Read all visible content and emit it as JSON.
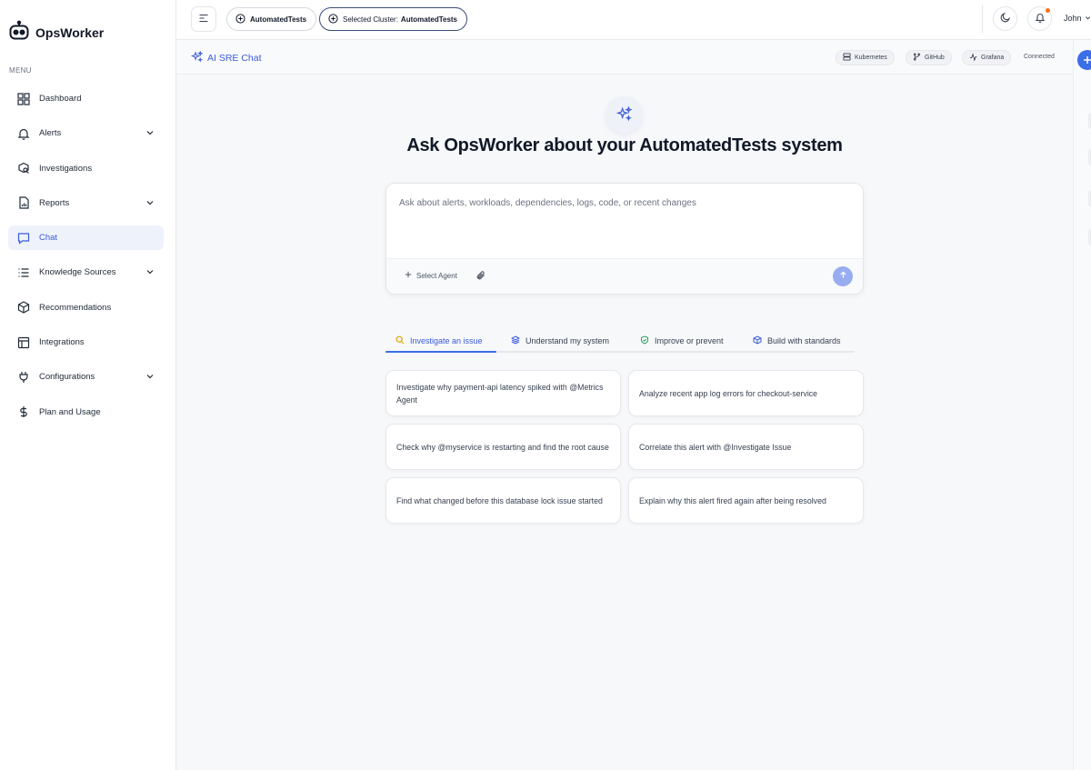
{
  "app": {
    "name": "OpsWorker"
  },
  "sidebar": {
    "menu_label": "MENU",
    "items": [
      {
        "label": "Dashboard",
        "icon": "grid-icon"
      },
      {
        "label": "Alerts",
        "icon": "bell-icon"
      },
      {
        "label": "Investigations",
        "icon": "search-box-icon"
      },
      {
        "label": "Reports",
        "icon": "report-icon"
      },
      {
        "label": "Chat",
        "icon": "chat-icon"
      },
      {
        "label": "Knowledge Sources",
        "icon": "list-icon"
      },
      {
        "label": "Recommendations",
        "icon": "cube-icon"
      },
      {
        "label": "Integrations",
        "icon": "table-icon"
      },
      {
        "label": "Configurations",
        "icon": "plug-icon"
      },
      {
        "label": "Plan and Usage",
        "icon": "dollar-icon"
      }
    ]
  },
  "topbar": {
    "workspace": "AutomatedTests",
    "cluster_prefix": "Selected Cluster:",
    "cluster_name": "AutomatedTests",
    "user": "John"
  },
  "subheader": {
    "title": "AI SRE Chat",
    "chips": [
      "Kubernetes",
      "GitHub",
      "Grafana"
    ],
    "status": "Connected"
  },
  "main": {
    "title": "Ask OpsWorker about your AutomatedTests system",
    "placeholder": "Ask about alerts, workloads, dependencies, logs, code, or recent changes",
    "select_agent": "Select Agent"
  },
  "tabs": [
    {
      "label": "Investigate an issue",
      "active": true
    },
    {
      "label": "Understand my system",
      "active": false
    },
    {
      "label": "Improve or prevent",
      "active": false
    },
    {
      "label": "Build with standards",
      "active": false
    }
  ],
  "suggestions": [
    "Investigate why payment-api latency spiked with @Metrics Agent",
    "Analyze recent app log errors for checkout-service",
    "Check why @myservice is restarting and find the root cause",
    "Correlate this alert with @Investigate Issue",
    "Find what changed before this database lock issue started",
    "Explain why this alert fired again after being resolved"
  ],
  "colors": {
    "accent": "#3b5bdb",
    "fab": "#3b6ee8",
    "send": "#98acf0",
    "notification": "#f97316"
  }
}
